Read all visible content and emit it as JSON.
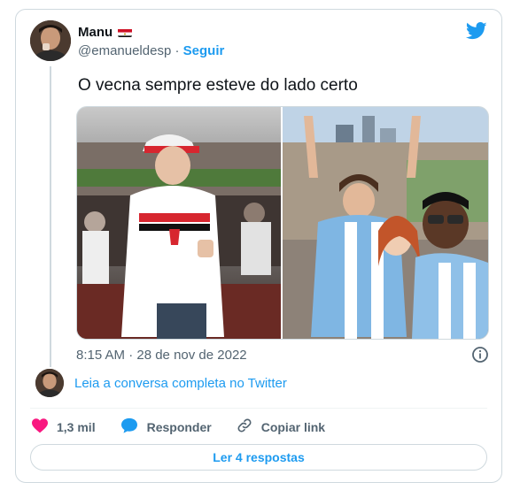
{
  "author": {
    "display_name": "Manu",
    "flag_icon": "egypt-flag-icon",
    "handle": "@emanueldesp",
    "separator": " · ",
    "follow_label": "Seguir"
  },
  "tweet": {
    "text": "O vecna sempre esteve do lado certo",
    "timestamp": "8:15 AM · 28 de nov de 2022"
  },
  "conversation": {
    "link_text": "Leia a conversa completa no Twitter"
  },
  "actions": {
    "like_count": "1,3 mil",
    "reply_label": "Responder",
    "copy_label": "Copiar link"
  },
  "replies_button": "Ler 4 respostas",
  "colors": {
    "accent": "#1d9bf0",
    "like": "#f91880",
    "muted": "#536471",
    "border": "#cfd9de"
  }
}
